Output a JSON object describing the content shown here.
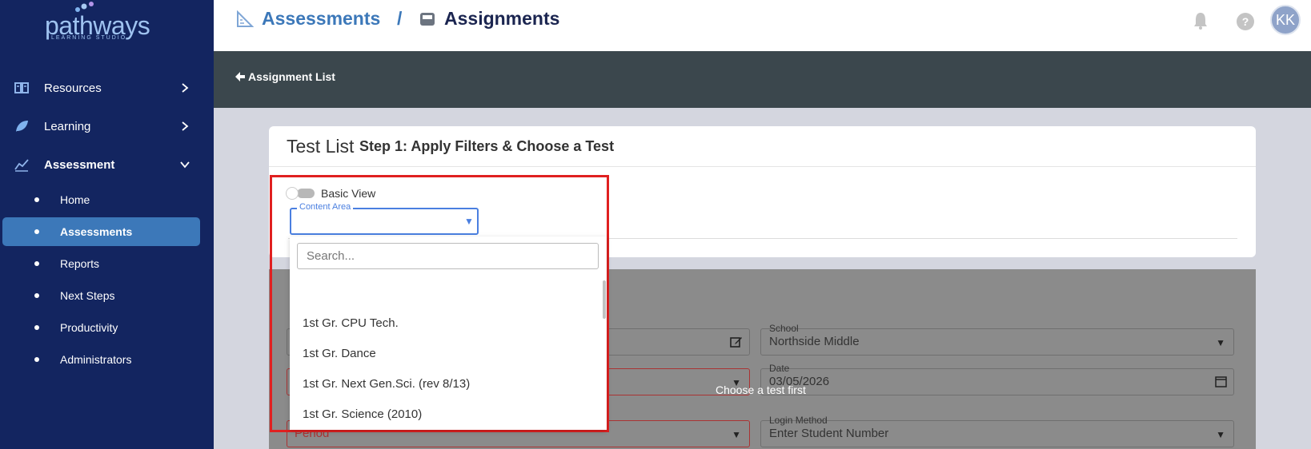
{
  "brand": {
    "name": "pathways",
    "tagline": "LEARNING STUDIO"
  },
  "sidebar": {
    "sections": [
      {
        "label": "Resources",
        "icon": "book-icon",
        "expanded": false
      },
      {
        "label": "Learning",
        "icon": "leaf-icon",
        "expanded": false
      },
      {
        "label": "Assessment",
        "icon": "chart-icon",
        "expanded": true
      }
    ],
    "items": [
      {
        "label": "Home",
        "active": false
      },
      {
        "label": "Assessments",
        "active": true
      },
      {
        "label": "Reports",
        "active": false
      },
      {
        "label": "Next Steps",
        "active": false
      },
      {
        "label": "Productivity",
        "active": false
      },
      {
        "label": "Administrators",
        "active": false
      }
    ]
  },
  "header": {
    "crumb1": "Assessments",
    "separator": "/",
    "crumb2": "Assignments",
    "avatar_initials": "KK",
    "help_icon": "?"
  },
  "toolbar": {
    "back_label": "Assignment List",
    "back_icon": "arrow-left-icon"
  },
  "card": {
    "title": "Test List",
    "step": "Step 1: Apply Filters & Choose a Test",
    "toggle_label": "Basic View",
    "content_area_label": "Content Area",
    "content_area_value": ""
  },
  "dropdown": {
    "search_placeholder": "Search...",
    "options": [
      "1st Gr. CPU Tech.",
      "1st Gr. Dance",
      "1st Gr. Next Gen.Sci. (rev 8/13)",
      "1st Gr. Science (2010)"
    ]
  },
  "form": {
    "school_label": "School",
    "school_value": "Northside Middle",
    "date_label": "Date",
    "date_value": "03/05/2026",
    "login_label": "Login Method",
    "login_value": "Enter Student Number",
    "period_value": "Period",
    "overlay_message": "Choose a test first"
  },
  "colors": {
    "sidebar": "#132560",
    "accent": "#3c78b9",
    "highlight": "#e02020"
  }
}
